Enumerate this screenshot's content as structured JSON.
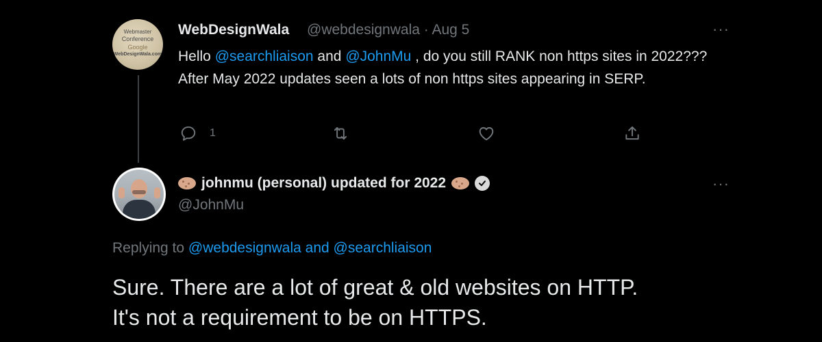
{
  "tweet1": {
    "author_name": "WebDesignWala",
    "handle": "@webdesignwala",
    "separator": "·",
    "date": "Aug 5",
    "more": "···",
    "avatar_text": [
      "Webmaster",
      "Conference",
      "Google",
      "WebDesignWala.com"
    ],
    "text_hello": "Hello ",
    "mention_a": "@searchliaison",
    "text_and": " and ",
    "mention_b": "@JohnMu",
    "text_rest": " , do you still RANK non https sites in 2022???",
    "text_line2": "After May 2022 updates seen a lots of non https sites appearing in SERP.",
    "actions": {
      "reply_icon": "reply-icon",
      "reply_count": "1",
      "retweet_icon": "retweet-icon",
      "like_icon": "heart-icon",
      "share_icon": "share-icon"
    }
  },
  "tweet2": {
    "author_name": "johnmu (personal) updated for 2022",
    "emoji": "potato-emoji",
    "verified_icon": "verified-badge-icon",
    "handle": "@JohnMu",
    "more": "···",
    "replying_prefix": "Replying to ",
    "replying_to": "@webdesignwala and @searchliaison",
    "text_line1": "Sure. There are a lot of great & old websites on HTTP.",
    "text_line2": "It's not a requirement to be on HTTPS."
  },
  "colors": {
    "background": "#000000",
    "text": "#e7e9ea",
    "muted": "#71767b",
    "link": "#1d9bf0",
    "thread_line": "#3e4144"
  }
}
